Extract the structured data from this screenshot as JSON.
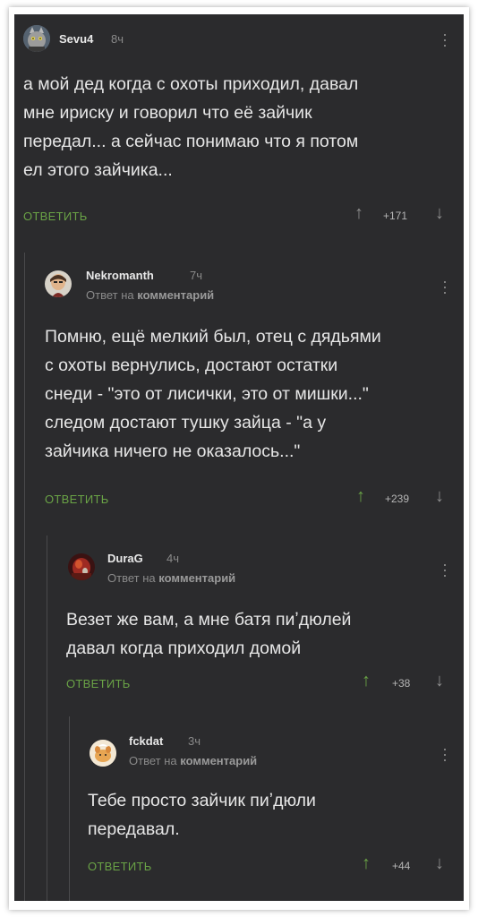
{
  "comments": [
    {
      "username": "Sevu4",
      "time": "8ч",
      "reply_prefix": "",
      "reply_link": "",
      "text": "а мой дед когда с охоты приходил, давал\nмне ириску и говорил что её зайчик\nпередал... а сейчас понимаю что я потом\nел этого зайчика...",
      "reply_label": "ОТВЕТИТЬ",
      "rating": "+171",
      "avatar_icon": "cat-avatar-icon"
    },
    {
      "username": "Nekromanth",
      "time": "7ч",
      "reply_prefix": "Ответ на",
      "reply_link": "комментарий",
      "text": "Помню, ещё мелкий был, отец с дядьями\nс охоты вернулись, достают остатки\nснеди - \"это от лисички, это от мишки...\"\nследом достают тушку зайца - \"а у\nзайчика ничего не оказалось...\"",
      "reply_label": "ОТВЕТИТЬ",
      "rating": "+239",
      "avatar_icon": "person-avatar-icon"
    },
    {
      "username": "DuraG",
      "time": "4ч",
      "reply_prefix": "Ответ на",
      "reply_link": "комментарий",
      "text": "Везет же вам, а мне батя пиʼдюлей\nдавал когда приходил домой",
      "reply_label": "ОТВЕТИТЬ",
      "rating": "+38",
      "avatar_icon": "red-avatar-icon"
    },
    {
      "username": "fckdat",
      "time": "3ч",
      "reply_prefix": "Ответ на",
      "reply_link": "комментарий",
      "text": "Тебе просто зайчик пиʼдюли\nпередавал.",
      "reply_label": "ОТВЕТИТЬ",
      "rating": "+44",
      "avatar_icon": "dog-avatar-icon"
    }
  ],
  "colors": {
    "background": "#2b2b2d",
    "text": "#e6e6e6",
    "muted": "#8a8a8a",
    "accent_green": "#6aa346",
    "thread_line": "#4a4a4c"
  }
}
